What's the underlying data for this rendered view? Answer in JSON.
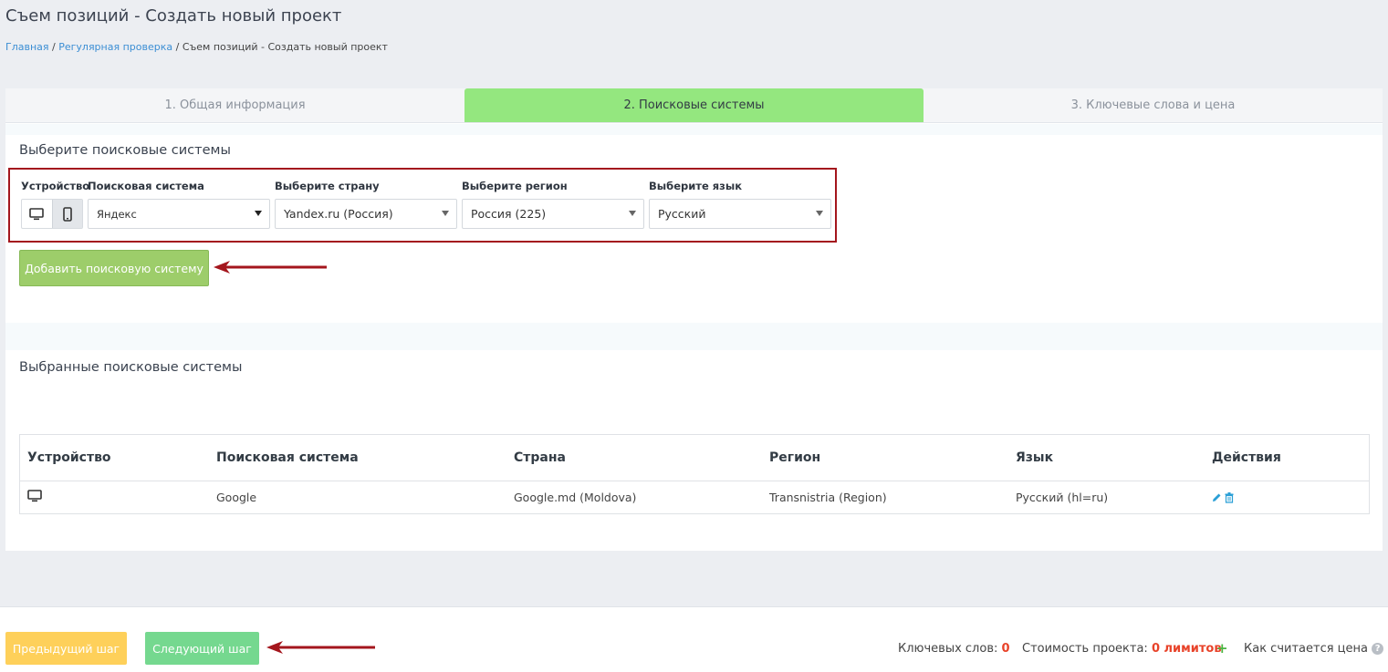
{
  "page": {
    "title": "Съем позиций - Создать новый проект",
    "breadcrumb": [
      "Главная",
      "Регулярная проверка",
      "Съем позиций - Создать новый проект"
    ]
  },
  "tabs": [
    {
      "label": "1. Общая информация",
      "active": false
    },
    {
      "label": "2. Поисковые системы",
      "active": true
    },
    {
      "label": "3. Ключевые слова и цена",
      "active": false
    }
  ],
  "selector": {
    "section_title": "Выберите поисковые системы",
    "device_label": "Устройство",
    "engine_label": "Поисковая система",
    "engine_value": "Яндекс",
    "country_label": "Выберите страну",
    "country_value": "Yandex.ru (Россия)",
    "region_label": "Выберите регион",
    "region_value": "Россия (225)",
    "language_label": "Выберите язык",
    "language_value": "Русский",
    "add_button": "Добавить поисковую систему"
  },
  "selected": {
    "section_title": "Выбранные поисковые системы",
    "columns": [
      "Устройство",
      "Поисковая система",
      "Страна",
      "Регион",
      "Язык",
      "Действия"
    ],
    "rows": [
      {
        "device_icon": "desktop-icon",
        "engine": "Google",
        "country": "Google.md (Moldova)",
        "region": "Transnistria (Region)",
        "language": "Русский (hl=ru)"
      }
    ]
  },
  "footer": {
    "prev_button": "Предыдущий шаг",
    "next_button": "Следующий шаг",
    "keywords_label": "Ключевых слов:",
    "keywords_value": "0",
    "cost_label": "Стоимость проекта:",
    "cost_value": "0 лимитов",
    "plus": "+",
    "how_label": "Как считается цена",
    "help": "?"
  },
  "colors": {
    "active_tab": "#94e77f",
    "add_button": "#9dcd6a",
    "prev_button": "#fed05a",
    "next_button": "#75d88f",
    "annotation": "#a4161d",
    "accent": "#e8432a"
  }
}
